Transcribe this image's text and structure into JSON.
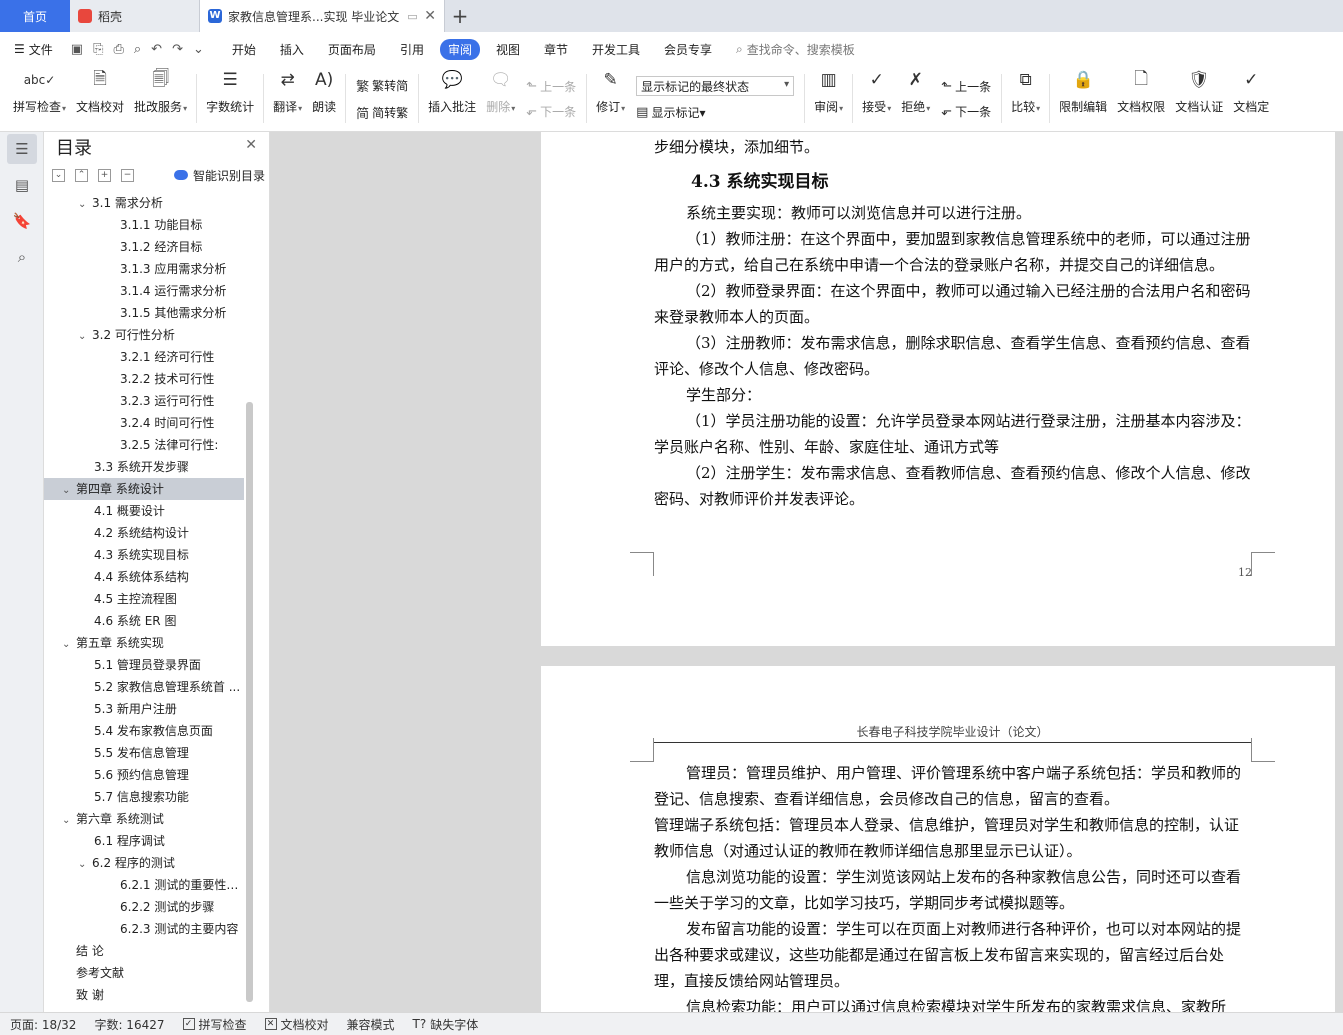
{
  "tabs": {
    "home": "首页",
    "daoke": "稻壳",
    "doc": "家教信息管理系...实现 毕业论文"
  },
  "menu": {
    "file": "文件",
    "items": [
      "开始",
      "插入",
      "页面布局",
      "引用",
      "审阅",
      "视图",
      "章节",
      "开发工具",
      "会员专享"
    ],
    "active": "审阅",
    "search_placeholder": "查找命令、搜索模板"
  },
  "ribbon": {
    "spell_check": "拼写检查",
    "doc_proofread": "文档校对",
    "annotate_service": "批改服务",
    "word_count": "字数统计",
    "translate": "翻译",
    "read_aloud": "朗读",
    "trad_to_simp": "繁转简",
    "simp_to_trad": "简转繁",
    "insert_comment": "插入批注",
    "delete": "删除",
    "prev_comment": "上一条",
    "next_comment": "下一条",
    "revise": "修订",
    "markup_state": "显示标记的最终状态",
    "show_markup": "显示标记",
    "review": "审阅",
    "accept": "接受",
    "reject": "拒绝",
    "prev_change": "上一条",
    "next_change": "下一条",
    "compare": "比较",
    "restrict_edit": "限制编辑",
    "doc_permission": "文档权限",
    "doc_cert": "文档认证",
    "doc_final": "文档定"
  },
  "toc": {
    "title": "目录",
    "smart": "智能识别目录",
    "items": [
      {
        "text": "3.1 需求分析",
        "level": 2,
        "chev": true
      },
      {
        "text": "3.1.1 功能目标",
        "level": 3
      },
      {
        "text": "3.1.2 经济目标",
        "level": 3
      },
      {
        "text": "3.1.3 应用需求分析",
        "level": 3
      },
      {
        "text": "3.1.4 运行需求分析",
        "level": 3
      },
      {
        "text": "3.1.5 其他需求分析",
        "level": 3
      },
      {
        "text": "3.2 可行性分析",
        "level": 2,
        "chev": true
      },
      {
        "text": "3.2.1 经济可行性",
        "level": 3
      },
      {
        "text": "3.2.2 技术可行性",
        "level": 3
      },
      {
        "text": "3.2.3  运行可行性",
        "level": 3
      },
      {
        "text": "3.2.4  时间可行性",
        "level": 3
      },
      {
        "text": "3.2.5  法律可行性:",
        "level": 3
      },
      {
        "text": "3.3 系统开发步骤",
        "level": 2
      },
      {
        "text": "第四章       系统设计",
        "level": 1,
        "chev": true,
        "selected": true
      },
      {
        "text": "4.1 概要设计",
        "level": 2
      },
      {
        "text": "4.2 系统结构设计",
        "level": 2
      },
      {
        "text": "4.3 系统实现目标",
        "level": 2
      },
      {
        "text": "4.4 系统体系结构",
        "level": 2
      },
      {
        "text": "4.5 主控流程图",
        "level": 2
      },
      {
        "text": "4.6 系统 ER 图",
        "level": 2
      },
      {
        "text": "第五章       系统实现",
        "level": 1,
        "chev": true
      },
      {
        "text": "5.1 管理员登录界面",
        "level": 2
      },
      {
        "text": "5.2 家教信息管理系统首 ...",
        "level": 2
      },
      {
        "text": "5.3 新用户注册",
        "level": 2
      },
      {
        "text": "5.4 发布家教信息页面",
        "level": 2
      },
      {
        "text": "5.5 发布信息管理",
        "level": 2
      },
      {
        "text": "5.6 预约信息管理",
        "level": 2
      },
      {
        "text": "5.7 信息搜索功能",
        "level": 2
      },
      {
        "text": "第六章       系统测试",
        "level": 1,
        "chev": true
      },
      {
        "text": "6.1  程序调试",
        "level": 2
      },
      {
        "text": "6.2  程序的测试",
        "level": 2,
        "chev": true
      },
      {
        "text": "6.2.1  测试的重要性及 ...",
        "level": 3
      },
      {
        "text": "6.2.2  测试的步骤",
        "level": 3
      },
      {
        "text": "6.2.3  测试的主要内容",
        "level": 3
      },
      {
        "text": "结     论",
        "level": 1
      },
      {
        "text": "参考文献",
        "level": 1
      },
      {
        "text": "致     谢",
        "level": 1
      }
    ]
  },
  "page1": {
    "top_line": "步细分模块，添加细节。",
    "heading": "4.3 系统实现目标",
    "paragraphs": [
      "系统主要实现：教师可以浏览信息并可以进行注册。",
      "（1）教师注册：在这个界面中，要加盟到家教信息管理系统中的老师，可以通过注册用户的方式，给自己在系统中申请一个合法的登录账户名称，并提交自己的详细信息。",
      "（2）教师登录界面：在这个界面中，教师可以通过输入已经注册的合法用户名和密码来登录教师本人的页面。",
      "（3）注册教师：发布需求信息，删除求职信息、查看学生信息、查看预约信息、查看评论、修改个人信息、修改密码。",
      "学生部分：",
      "（1）学员注册功能的设置：允许学员登录本网站进行登录注册，注册基本内容涉及：学员账户名称、性别、年龄、家庭住址、通讯方式等",
      "（2）注册学生：发布需求信息、查看教师信息、查看预约信息、修改个人信息、修改密码、对教师评价并发表评论。"
    ],
    "page_number": "12"
  },
  "page2": {
    "header": "长春电子科技学院毕业设计（论文）",
    "paragraphs": [
      "管理员：管理员维护、用户管理、评价管理系统中客户端子系统包括：学员和教师的登记、信息搜索、查看详细信息，会员修改自己的信息，留言的查看。",
      "管理端子系统包括：管理员本人登录、信息维护，管理员对学生和教师信息的控制，认证教师信息（对通过认证的教师在教师详细信息那里显示已认证）。",
      "信息浏览功能的设置：学生浏览该网站上发布的各种家教信息公告，同时还可以查看一些关于学习的文章，比如学习技巧，学期同步考试模拟题等。",
      "发布留言功能的设置：学生可以在页面上对教师进行各种评价，也可以对本网站的提出各种要求或建议，这些功能都是通过在留言板上发布留言来实现的，留言经过后台处理，直接反馈给网站管理员。",
      "信息检索功能：用户可以通过信息检索模块对学生所发布的家教需求信息、家教所"
    ]
  },
  "status": {
    "page": "页面: 18/32",
    "words": "字数: 16427",
    "spell": "拼写检查",
    "proof": "文档校对",
    "compat": "兼容模式",
    "missing_font": "缺失字体"
  }
}
